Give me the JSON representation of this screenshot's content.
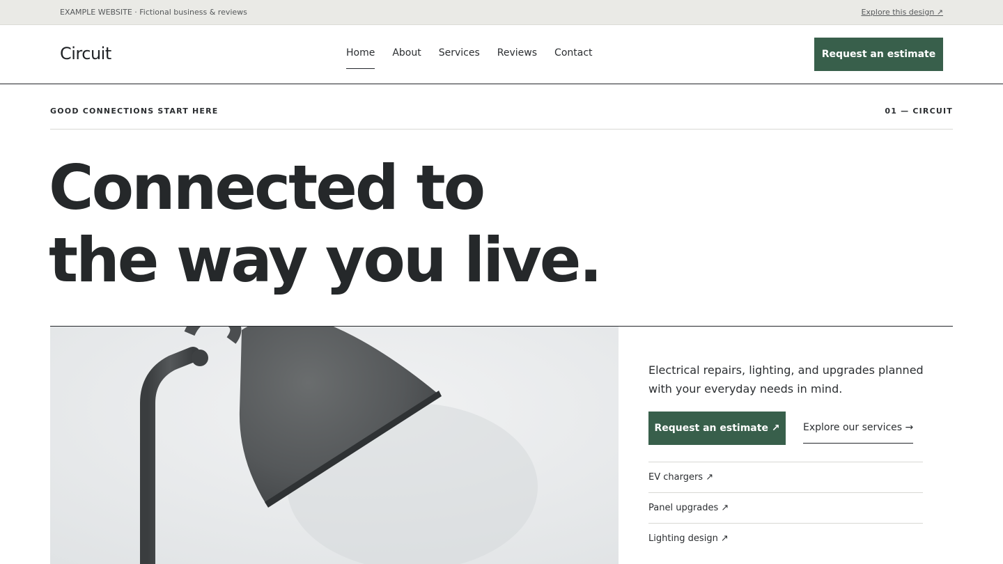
{
  "topbar": {
    "notice": "EXAMPLE WEBSITE · Fictional business & reviews",
    "explore_link": "Explore this design ↗"
  },
  "header": {
    "logo": "Circuit",
    "nav": [
      "Home",
      "About",
      "Services",
      "Reviews",
      "Contact"
    ],
    "active_nav": "Home",
    "cta": "Request an estimate"
  },
  "hero": {
    "eyebrow_left": "GOOD CONNECTIONS START HERE",
    "eyebrow_right": "01 — CIRCUIT",
    "headline_line1": "Connected to",
    "headline_line2": "the way you live.",
    "intro": "Electrical repairs, lighting, and upgrades planned with your everyday needs in mind.",
    "primary_cta": "Request an estimate ↗",
    "secondary_cta": "Explore our services →",
    "services": [
      "EV chargers ↗",
      "Panel upgrades ↗",
      "Lighting design ↗"
    ]
  },
  "colors": {
    "accent": "#385f4b",
    "text": "#23262a",
    "topbar_bg": "#eaeae6"
  },
  "icons": {
    "external": "arrow-up-right-icon",
    "forward": "arrow-right-icon",
    "hero_image": "desk-lamp-photo"
  }
}
